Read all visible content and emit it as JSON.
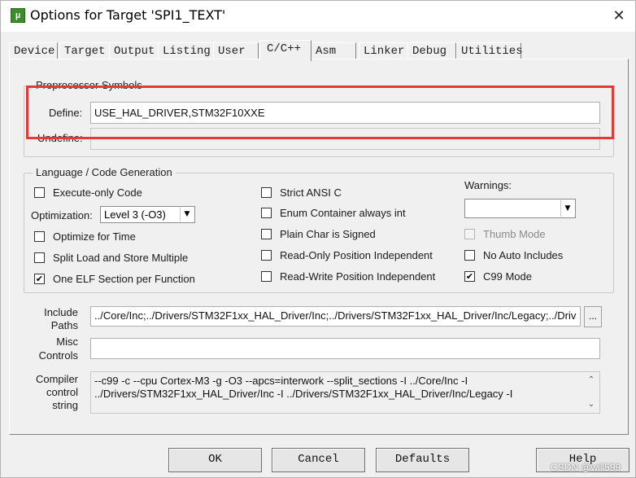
{
  "window": {
    "title": "Options for Target 'SPI1_TEXT'",
    "close_glyph": "✕",
    "icon_text": "µ"
  },
  "tabs": [
    {
      "label": "Device"
    },
    {
      "label": "Target"
    },
    {
      "label": "Output"
    },
    {
      "label": "Listing"
    },
    {
      "label": "User"
    },
    {
      "label": "C/C++",
      "active": true
    },
    {
      "label": "Asm"
    },
    {
      "label": "Linker"
    },
    {
      "label": "Debug"
    },
    {
      "label": "Utilities"
    }
  ],
  "preprocessor": {
    "group_title": "Preprocessor Symbols",
    "define_label": "Define:",
    "define_value": "USE_HAL_DRIVER,STM32F10XXE",
    "undefine_label": "Undefine:",
    "undefine_value": ""
  },
  "language": {
    "group_title": "Language / Code Generation",
    "execute_only": {
      "label": "Execute-only Code",
      "checked": false
    },
    "optimization_label": "Optimization:",
    "optimization_value": "Level 3 (-O3)",
    "optimize_time": {
      "label": "Optimize for Time",
      "checked": false
    },
    "split_load": {
      "label": "Split Load and Store Multiple",
      "checked": false
    },
    "one_elf": {
      "label": "One ELF Section per Function",
      "checked": true
    },
    "strict_ansi": {
      "label": "Strict ANSI C",
      "checked": false
    },
    "enum_container": {
      "label": "Enum Container always int",
      "checked": false
    },
    "plain_char": {
      "label": "Plain Char is Signed",
      "checked": false
    },
    "ropi": {
      "label": "Read-Only Position Independent",
      "checked": false
    },
    "rwpi": {
      "label": "Read-Write Position Independent",
      "checked": false
    },
    "warnings_label": "Warnings:",
    "warnings_value": "",
    "thumb_mode": {
      "label": "Thumb Mode",
      "checked": false,
      "disabled": true
    },
    "no_auto_includes": {
      "label": "No Auto Includes",
      "checked": false
    },
    "c99_mode": {
      "label": "C99 Mode",
      "checked": true
    }
  },
  "include_paths": {
    "label_line1": "Include",
    "label_line2": "Paths",
    "value": "../Core/Inc;../Drivers/STM32F1xx_HAL_Driver/Inc;../Drivers/STM32F1xx_HAL_Driver/Inc/Legacy;../Driv",
    "browse_label": "..."
  },
  "misc_controls": {
    "label_line1": "Misc",
    "label_line2": "Controls",
    "value": ""
  },
  "compiler_control": {
    "label_line1": "Compiler",
    "label_line2": "control",
    "label_line3": "string",
    "line1": "--c99 -c --cpu Cortex-M3 -g -O3 --apcs=interwork --split_sections -I ../Core/Inc -I",
    "line2": "../Drivers/STM32F1xx_HAL_Driver/Inc -I ../Drivers/STM32F1xx_HAL_Driver/Inc/Legacy -I"
  },
  "buttons": {
    "ok": "OK",
    "cancel": "Cancel",
    "defaults": "Defaults",
    "help": "Help"
  },
  "watermark": "CSDN @will599",
  "colors": {
    "highlight": "#e53935"
  }
}
